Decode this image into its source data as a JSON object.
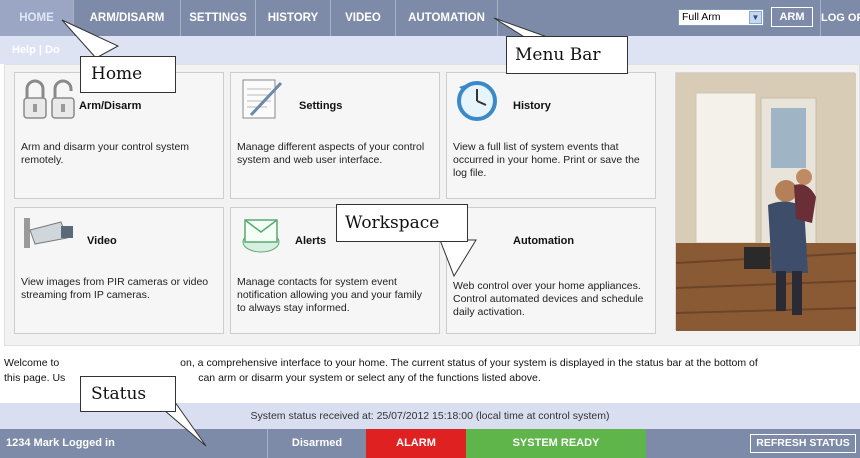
{
  "menu": {
    "tabs": [
      {
        "label": "HOME"
      },
      {
        "label": "ARM/DISARM"
      },
      {
        "label": "SETTINGS"
      },
      {
        "label": "HISTORY"
      },
      {
        "label": "VIDEO"
      },
      {
        "label": "AUTOMATION"
      }
    ],
    "mode_select_value": "Full Arm",
    "arm_button": "ARM",
    "logoff": "LOG OFF"
  },
  "help": {
    "text": "Help | Do"
  },
  "cards": [
    {
      "title": "Arm/Disarm",
      "desc": "Arm and disarm your control system remotely."
    },
    {
      "title": "Settings",
      "desc": "Manage different aspects of your control system and web user interface."
    },
    {
      "title": "History",
      "desc": "View a full list of system events that occurred in your home. Print or save the log file."
    },
    {
      "title": "Video",
      "desc": "View images from PIR cameras or video streaming from IP cameras."
    },
    {
      "title": "Alerts",
      "desc": "Manage contacts for system event notification allowing you and your family to always stay informed."
    },
    {
      "title": "Automation",
      "desc": "Web control over your home appliances. Control automated devices and schedule daily activation."
    }
  ],
  "welcome": {
    "line1_a": "Welcome to",
    "line1_b": "on, a comprehensive interface to your home. The current status of your system is displayed in the status bar at the bottom of",
    "line2_a": "this page. Us",
    "line2_b": "can arm or disarm your system or select any of the functions listed above."
  },
  "status": {
    "received": "System status received at: 25/07/2012 15:18:00 (local time at control system)",
    "user": "1234 Mark Logged in",
    "disarmed": "Disarmed",
    "alarm": "ALARM",
    "ready": "SYSTEM READY",
    "refresh": "REFRESH STATUS"
  },
  "callouts": {
    "home": "Home",
    "menu_bar": "Menu Bar",
    "workspace": "Workspace",
    "status": "Status"
  },
  "colors": {
    "menu_bar": "#7d8aa8",
    "alarm": "#e02121",
    "ready": "#5fb54a"
  }
}
